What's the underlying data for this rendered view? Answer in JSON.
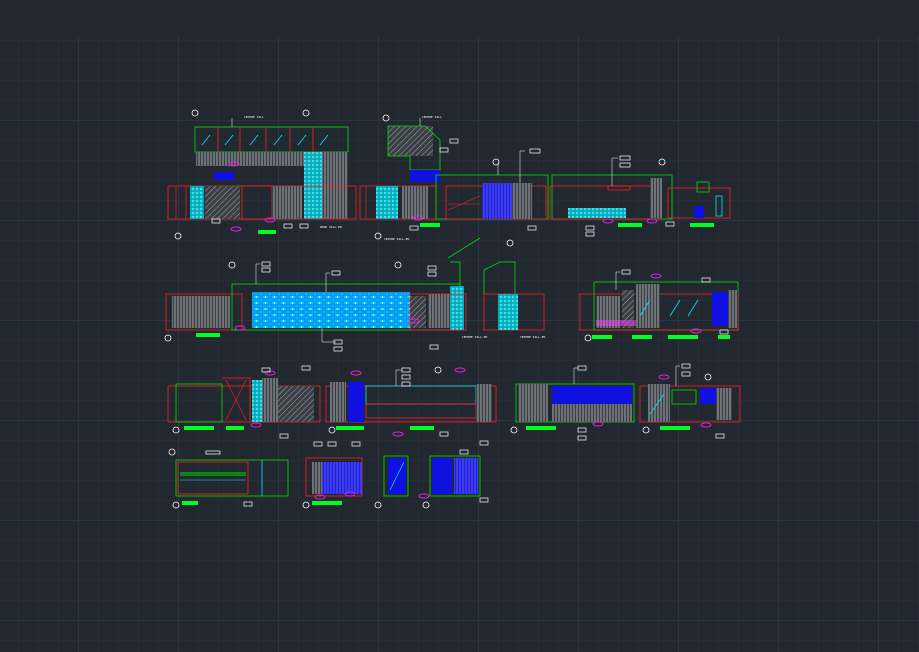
{
  "colors": {
    "background": "#212830",
    "grid_major": "#2c3440",
    "grid_minor": "#262d36",
    "outline_red": "#ff2020",
    "outline_green": "#00e000",
    "hatch_grey": "#b8b8b8",
    "fill_cyan": "#00d8e8",
    "fill_blue": "#1010e0",
    "tag_magenta": "#e020e0",
    "label_green": "#00ff20",
    "text_white": "#ffffff"
  },
  "elevations": {
    "row1": [
      {
        "notes": [
          "CENTRE SILL",
          "WOOD SILL-PR"
        ]
      },
      {
        "notes": [
          "CENTRE SILL",
          "CENTRE SILL-PR"
        ]
      },
      {
        "notes": []
      },
      {
        "notes": []
      }
    ],
    "row2": [
      {
        "notes": []
      },
      {
        "notes": [
          "CENTRE SILL-PR",
          "CENTRE SILL-PR"
        ]
      },
      {
        "notes": []
      }
    ]
  }
}
